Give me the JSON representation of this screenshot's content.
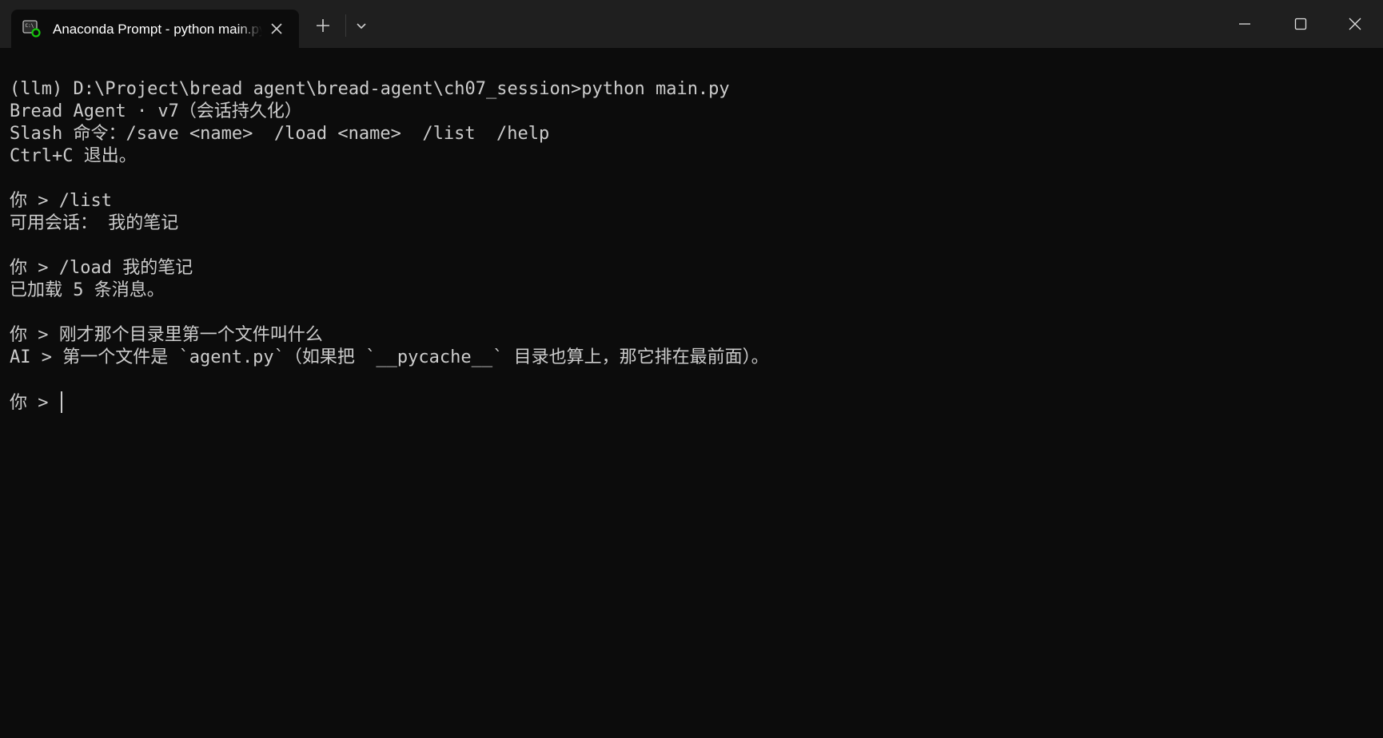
{
  "tab": {
    "title": "Anaconda Prompt - python  main.py",
    "icon": "terminal-icon"
  },
  "window_controls": [
    "minimize-icon",
    "maximize-icon",
    "close-icon"
  ],
  "colors": {
    "background": "#0c0c0c",
    "titlebar": "#1f1f1f",
    "text": "#cccccc",
    "icon_badge": "#16c60c"
  },
  "terminal": {
    "lines": [
      "(llm) D:\\Project\\bread agent\\bread-agent\\ch07_session>python main.py",
      "Bread Agent · v7（会话持久化）",
      "Slash 命令：/save <name>  /load <name>  /list  /help",
      "Ctrl+C 退出。",
      "",
      "你 > /list",
      "可用会话： 我的笔记",
      "",
      "你 > /load 我的笔记",
      "已加载 5 条消息。",
      "",
      "你 > 刚才那个目录里第一个文件叫什么",
      "AI > 第一个文件是 `agent.py`（如果把 `__pycache__` 目录也算上，那它排在最前面）。",
      ""
    ],
    "prompt": "你 > "
  }
}
